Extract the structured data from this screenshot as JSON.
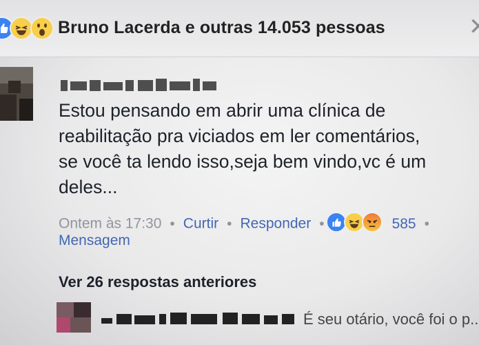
{
  "header": {
    "reactions": [
      "like",
      "haha",
      "wow"
    ],
    "title": "Bruno Lacerda e outras 14.053 pessoas",
    "close_icon": "close-icon"
  },
  "comment": {
    "author_obscured": "pixelated author name",
    "text_lines": [
      "Estou pensando em abrir uma clínica de",
      "reabilitação pra viciados em ler comentários,",
      "se você ta lendo isso,seja bem vindo,vc é um",
      "deles..."
    ],
    "time": "Ontem às 17:30",
    "like_label": "Curtir",
    "reply_label": "Responder",
    "reactions": [
      "like",
      "haha",
      "angry"
    ],
    "reaction_count": "585",
    "message_label": "Mensagem"
  },
  "previous_replies_label": "Ver 26 respostas anteriores",
  "reply": {
    "author_obscured": "pixelated reply author",
    "text": "É seu otário, você foi o p..."
  },
  "colors": {
    "link_blue": "#4267b2",
    "like_blue": "#3b82f3",
    "reaction_yellow": "#f7cf4a"
  }
}
